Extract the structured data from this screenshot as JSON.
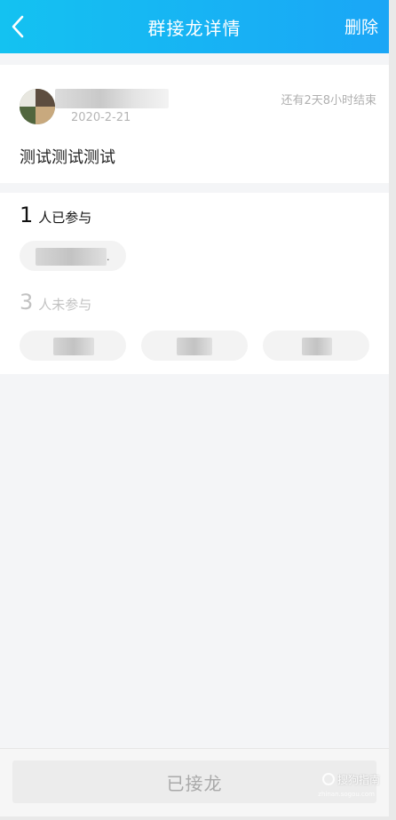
{
  "header": {
    "title": "群接龙详情",
    "action_label": "删除"
  },
  "post": {
    "date": "2020-2-21",
    "remaining_time": "还有2天8小时结束",
    "content": "测试测试测试"
  },
  "participants": {
    "joined_count": "1",
    "joined_label": "人已参与",
    "not_joined_count": "3",
    "not_joined_label": "人未参与"
  },
  "bottom": {
    "button_label": "已接龙"
  },
  "watermark": {
    "text": "搜狗指南",
    "sub": "zhinan.sogou.com"
  },
  "colors": {
    "header_start": "#14c2f1",
    "header_end": "#1aa6f6",
    "disabled_text": "#a9a9a9"
  }
}
